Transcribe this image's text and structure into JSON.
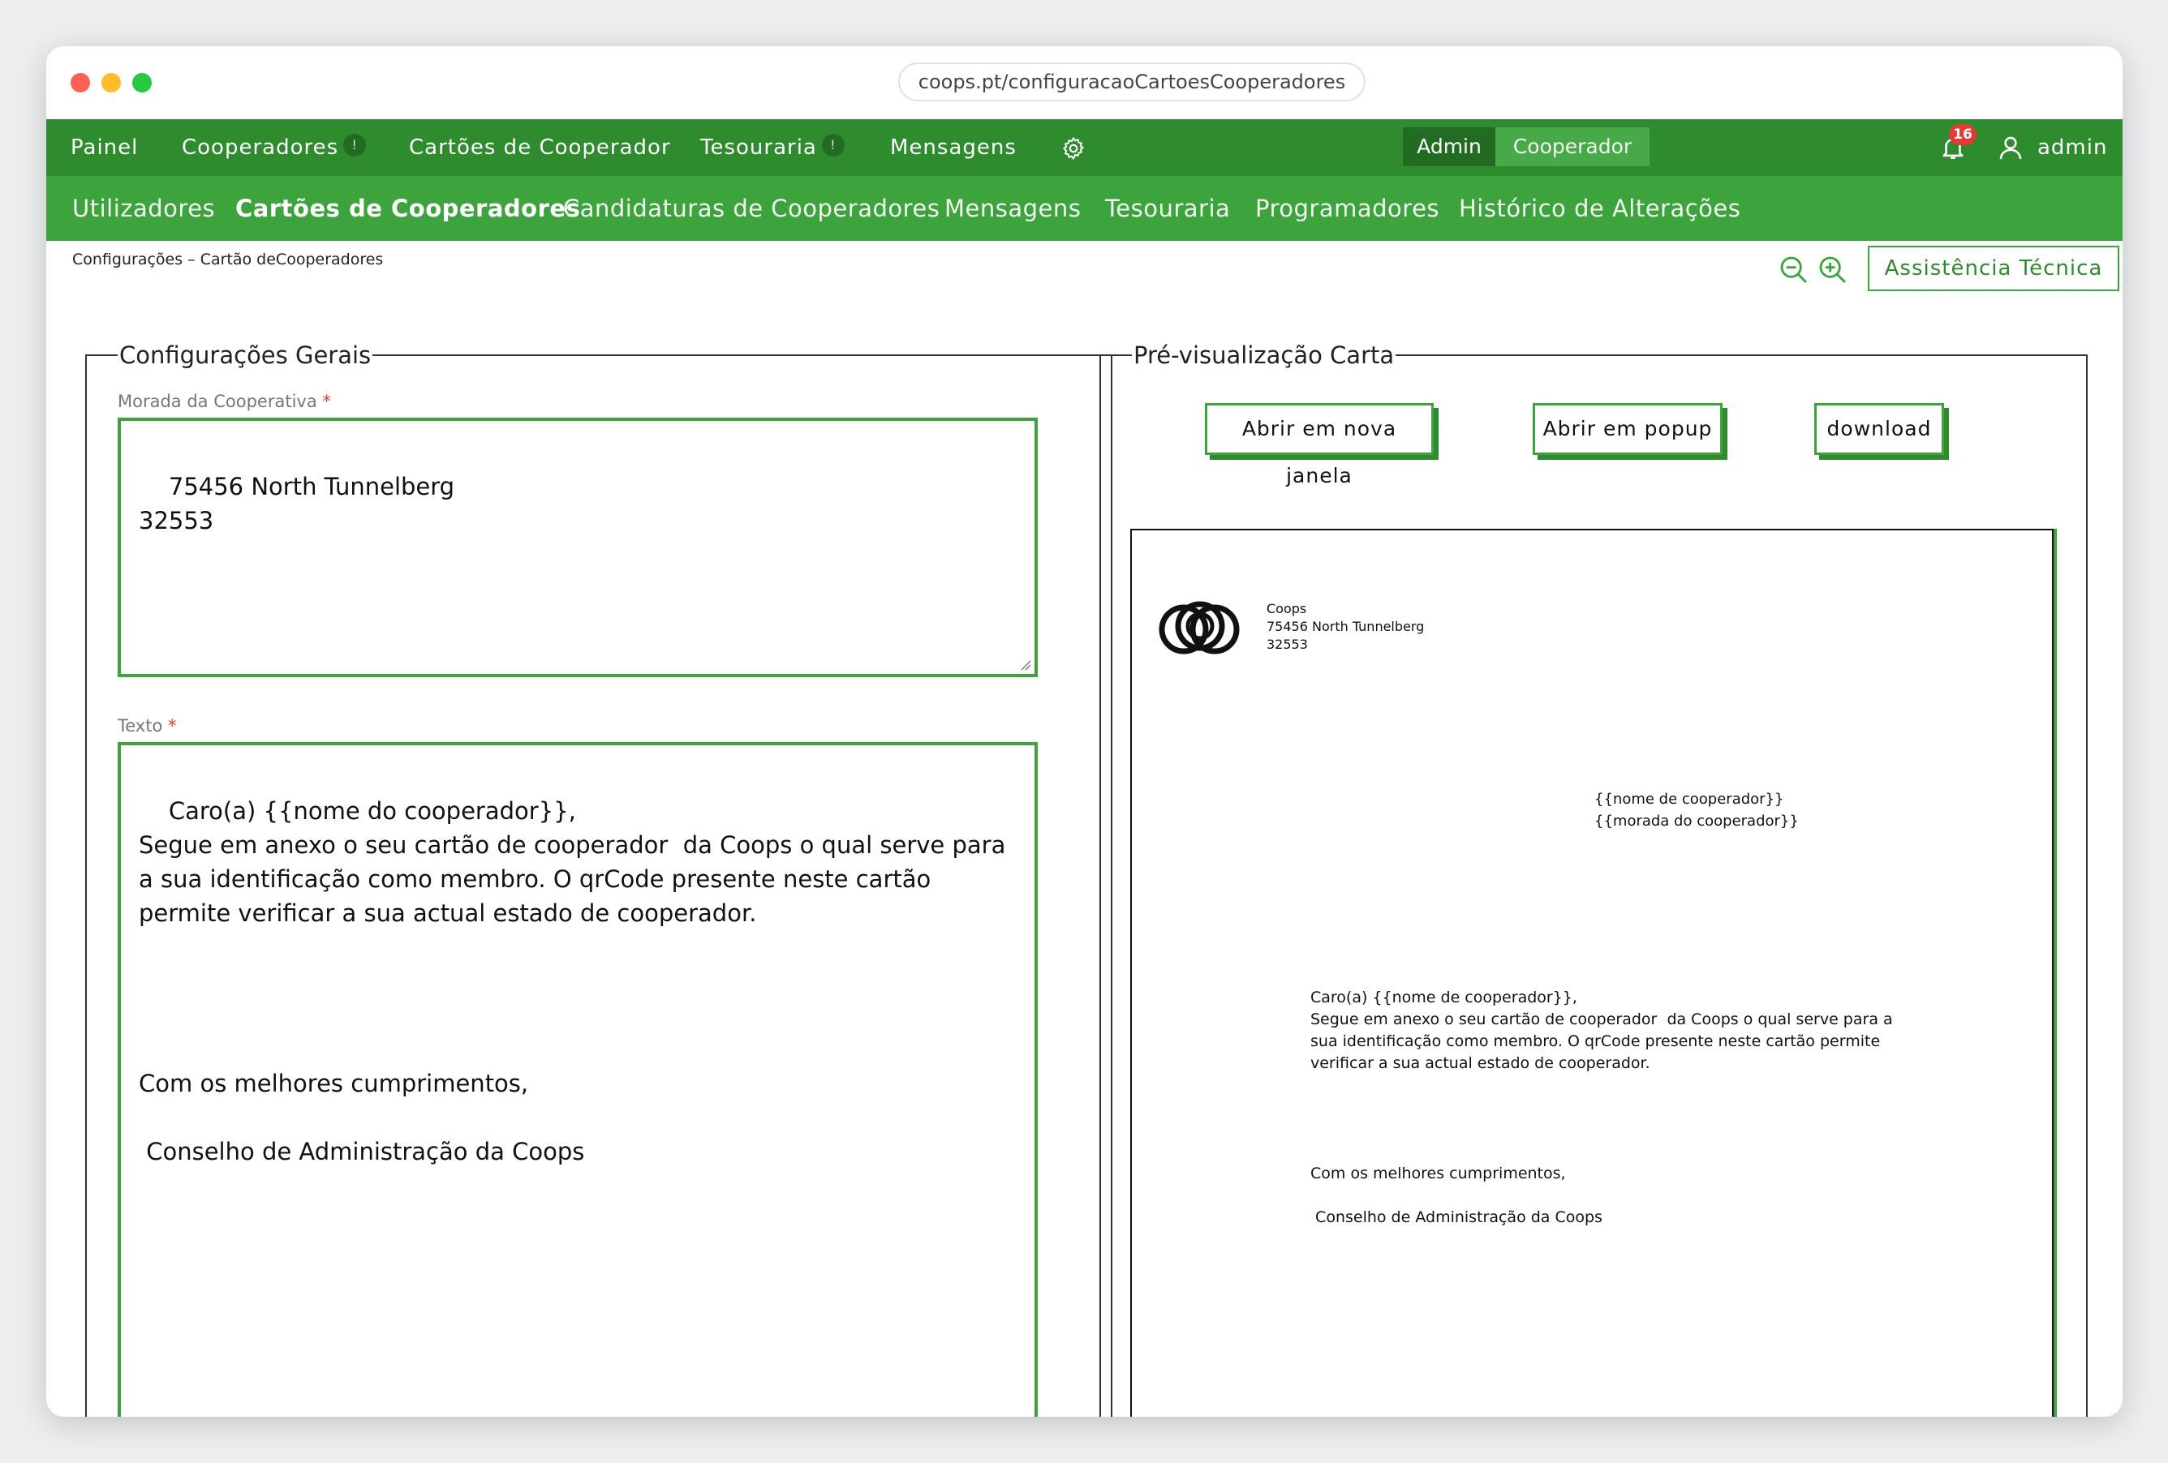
{
  "browser": {
    "url": "coops.pt/configuracaoCartoesCooperadores"
  },
  "topnav": {
    "items": [
      {
        "label": "Painel"
      },
      {
        "label": "Cooperadores",
        "badge": "!"
      },
      {
        "label": "Cartões de Cooperador"
      },
      {
        "label": "Tesouraria",
        "badge": "!"
      },
      {
        "label": "Mensagens"
      }
    ],
    "settings_icon": "gear-icon",
    "role_toggle": {
      "admin": "Admin",
      "cooperador": "Cooperador",
      "selected": "Admin"
    },
    "notifications": {
      "icon": "bell-icon",
      "count": "16"
    },
    "user": {
      "icon": "user-icon",
      "name": "admin"
    }
  },
  "subnav": {
    "items": [
      {
        "label": "Utilizadores"
      },
      {
        "label": "Cartões de Cooperadores",
        "active": true
      },
      {
        "label": "Candidaturas de Cooperadores"
      },
      {
        "label": "Mensagens"
      },
      {
        "label": "Tesouraria"
      },
      {
        "label": "Programadores"
      },
      {
        "label": "Histórico de Alterações"
      }
    ]
  },
  "breadcrumb": "Configurações – Cartão deCooperadores",
  "toolbar": {
    "zoom_out_icon": "zoom-out-icon",
    "zoom_in_icon": "zoom-in-icon",
    "assist_label": "Assistência Técnica"
  },
  "general": {
    "legend": "Configurações Gerais",
    "address_label": "Morada da Cooperativa",
    "address_value": "75456 North Tunnelberg\n32553",
    "text_label": "Texto",
    "text_value": "Caro(a) {{nome do cooperador}},\nSegue em anexo o seu cartão de cooperador  da Coops o qual serve para a sua identificação como membro. O qrCode presente neste cartão permite verificar a sua actual estado de cooperador.\n\n\n\n\nCom os melhores cumprimentos,\n\n Conselho de Administração da Coops",
    "required_marker": "*"
  },
  "preview": {
    "legend": "Pré-visualização Carta",
    "buttons": {
      "new_window": "Abrir em nova janela",
      "popup": "Abrir em popup",
      "download": "download"
    },
    "letter": {
      "sender": "Coops\n75456 North Tunnelberg\n32553",
      "recipient": "{{nome de cooperador}}\n{{morada do cooperador}}",
      "body": "Caro(a) {{nome de cooperador}},\nSegue em anexo o seu cartão de cooperador  da Coops o qual serve para a sua identificação como membro. O qrCode presente neste cartão permite verificar a sua actual estado de cooperador.",
      "closing": "Com os melhores cumprimentos,\n\n Conselho de Administração da Coops"
    }
  },
  "colors": {
    "primary": "#2e8b2e",
    "secondary": "#3da33d",
    "dark": "#226b22",
    "badge_red": "#e53935"
  }
}
